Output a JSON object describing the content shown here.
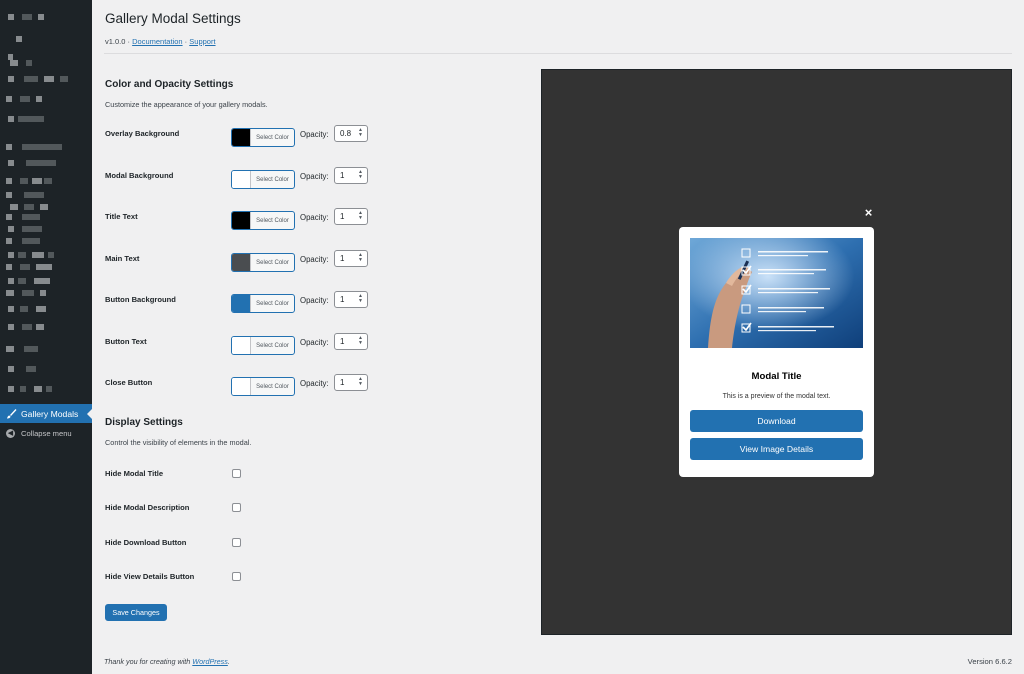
{
  "sidebar": {
    "active_label": "Gallery Modals",
    "collapse_label": "Collapse menu"
  },
  "header": {
    "title": "Gallery Modal Settings",
    "version": "v1.0.0",
    "separator": "·",
    "documentation_link": "Documentation",
    "support_link": "Support"
  },
  "color_section": {
    "title": "Color and Opacity Settings",
    "description": "Customize the appearance of your gallery modals.",
    "select_color_label": "Select Color",
    "opacity_label": "Opacity:",
    "rows": [
      {
        "label": "Overlay Background",
        "color": "#000000",
        "opacity": "0.8"
      },
      {
        "label": "Modal Background",
        "color": "#ffffff",
        "opacity": "1"
      },
      {
        "label": "Title Text",
        "color": "#000000",
        "opacity": "1"
      },
      {
        "label": "Main Text",
        "color": "#4a4d50",
        "opacity": "1"
      },
      {
        "label": "Button Background",
        "color": "#2271b1",
        "opacity": "1"
      },
      {
        "label": "Button Text",
        "color": "#ffffff",
        "opacity": "1"
      },
      {
        "label": "Close Button",
        "color": "#ffffff",
        "opacity": "1"
      }
    ]
  },
  "display_section": {
    "title": "Display Settings",
    "description": "Control the visibility of elements in the modal.",
    "rows": [
      {
        "label": "Hide Modal Title",
        "checked": false
      },
      {
        "label": "Hide Modal Description",
        "checked": false
      },
      {
        "label": "Hide Download Button",
        "checked": false
      },
      {
        "label": "Hide View Details Button",
        "checked": false
      }
    ]
  },
  "save_label": "Save Changes",
  "preview": {
    "close_icon": "×",
    "modal_title": "Modal Title",
    "modal_text": "This is a preview of the modal text.",
    "download_label": "Download",
    "details_label": "View Image Details"
  },
  "footer": {
    "thanks_prefix": "Thank you for creating with ",
    "wordpress_link": "WordPress",
    "thanks_suffix": ".",
    "version": "Version 6.6.2"
  },
  "colors": {
    "accent": "#2271b1",
    "sidebar_bg": "#1d2327",
    "preview_bg": "#333333"
  }
}
